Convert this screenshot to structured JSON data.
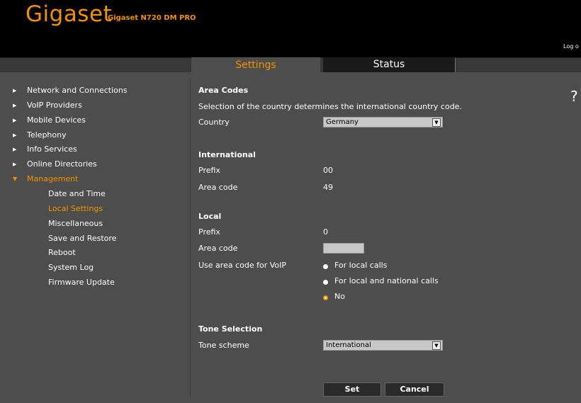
{
  "header": {
    "brand": "Gigaset",
    "model": "Gigaset N720 DM PRO",
    "logout": "Log o"
  },
  "tabs": [
    {
      "label": "Settings",
      "active": true
    },
    {
      "label": "Status",
      "active": false
    }
  ],
  "sidebar": {
    "items": [
      {
        "label": "Network and Connections"
      },
      {
        "label": "VoIP Providers"
      },
      {
        "label": "Mobile Devices"
      },
      {
        "label": "Telephony"
      },
      {
        "label": "Info Services"
      },
      {
        "label": "Online Directories"
      },
      {
        "label": "Management",
        "expanded": true
      }
    ],
    "subitems": [
      {
        "label": "Date and Time"
      },
      {
        "label": "Local Settings",
        "active": true
      },
      {
        "label": "Miscellaneous"
      },
      {
        "label": "Save and Restore"
      },
      {
        "label": "Reboot"
      },
      {
        "label": "System Log"
      },
      {
        "label": "Firmware Update"
      }
    ]
  },
  "help": "?",
  "content": {
    "area_codes_header": "Area Codes",
    "area_codes_desc": "Selection of the country determines the international country code.",
    "country_label": "Country",
    "country_value": "Germany",
    "international_header": "International",
    "intl_prefix_label": "Prefix",
    "intl_prefix_value": "00",
    "intl_area_code_label": "Area code",
    "intl_area_code_value": "49",
    "local_header": "Local",
    "local_prefix_label": "Prefix",
    "local_prefix_value": "0",
    "local_area_code_label": "Area code",
    "local_area_code_value": "",
    "use_area_code_label": "Use area code for VoIP",
    "radio_options": [
      {
        "label": "For local calls",
        "selected": false
      },
      {
        "label": "For local and national calls",
        "selected": false
      },
      {
        "label": "No",
        "selected": true
      }
    ],
    "tone_header": "Tone Selection",
    "tone_scheme_label": "Tone scheme",
    "tone_scheme_value": "International"
  },
  "buttons": {
    "set": "Set",
    "cancel": "Cancel"
  },
  "colors": {
    "accent": "#f39200",
    "background": "#4d4d4d",
    "topbar": "#000000"
  }
}
